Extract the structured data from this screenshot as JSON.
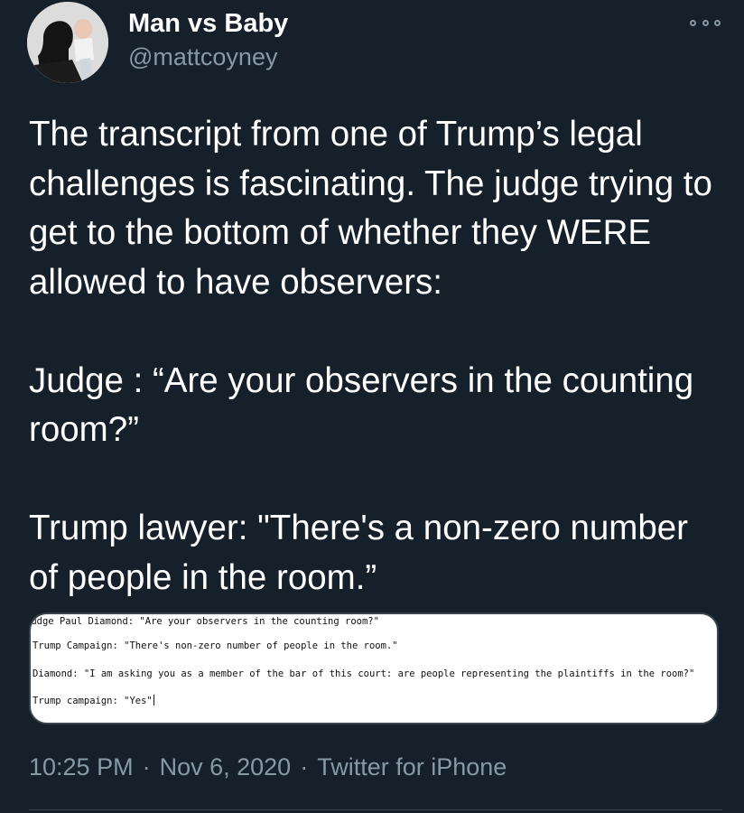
{
  "user": {
    "display_name": "Man vs Baby",
    "handle": "@mattcoyney"
  },
  "tweet": {
    "paragraphs": [
      "The transcript from one of Trump’s legal challenges is fascinating. The judge trying to get to the bottom of whether they WERE allowed to have observers:",
      "Judge : “Are your observers in the counting room?”",
      "Trump lawyer: \"There's a non-zero number of people in the room.”"
    ],
    "attachment_lines": [
      "Judge Paul Diamond: \"Are your observers in the counting room?\"",
      "Trump Campaign: \"There's non-zero number of people in the room.\"",
      "Diamond: \"I am asking you as a member of the bar of this court: are people representing the plaintiffs in the room?\"",
      "Trump campaign: \"Yes\""
    ]
  },
  "meta": {
    "time": "10:25 PM",
    "separator": "·",
    "date": "Nov 6, 2020",
    "source": "Twitter for iPhone"
  },
  "icons": {
    "more": "more-options-icon"
  }
}
